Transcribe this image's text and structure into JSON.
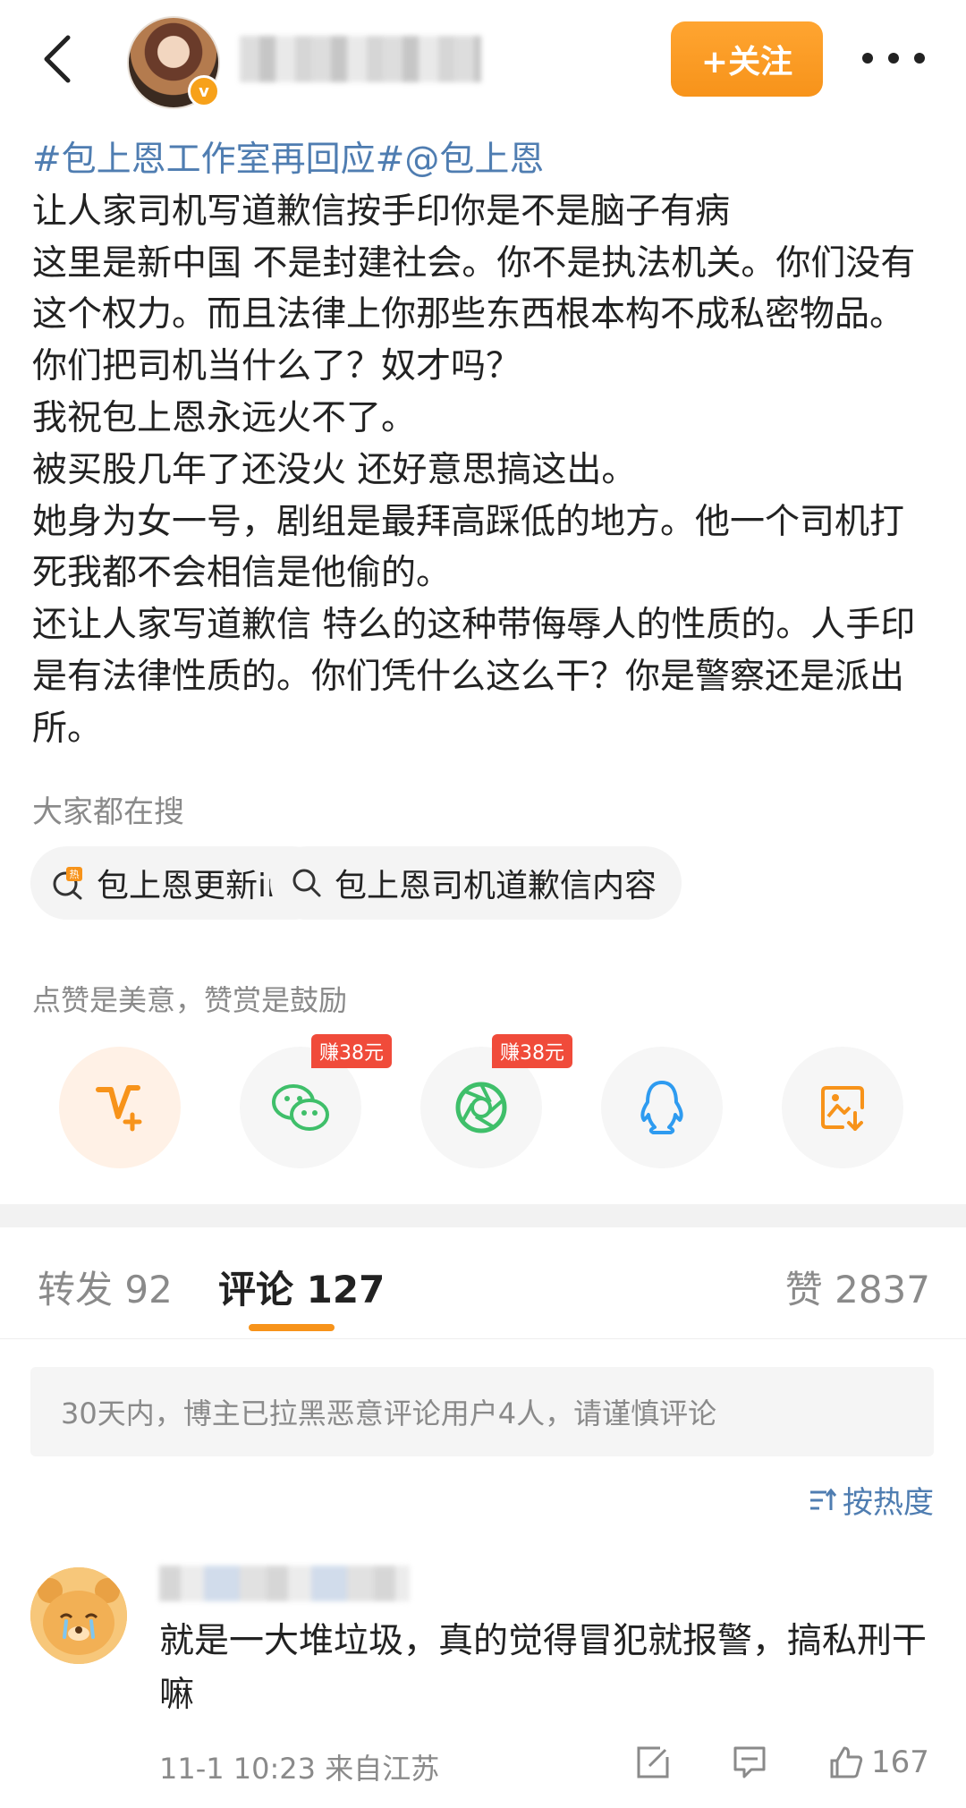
{
  "header": {
    "follow_label": "+关注"
  },
  "post": {
    "topic": "#包上恩工作室再回应#@包上恩",
    "lines": [
      "让人家司机写道歉信按手印你是不是脑子有病",
      "这里是新中国 不是封建社会。你不是执法机关。你们没有这个权力。而且法律上你那些东西根本构不成私密物品。你们把司机当什么了？奴才吗？",
      "我祝包上恩永远火不了。",
      "被买股几年了还没火 还好意思搞这出。",
      "她身为女一号，剧组是最拜高踩低的地方。他一个司机打死我都不会相信是他偷的。",
      "还让人家写道歉信 特么的这种带侮辱人的性质的。人手印是有法律性质的。你们凭什么这么干？你是警察还是派出所。"
    ]
  },
  "search": {
    "title": "大家都在搜",
    "chips": [
      "包上恩更新ins",
      "包上恩司机道歉信内容"
    ]
  },
  "reward": {
    "title": "点赞是美意，赞赏是鼓励",
    "earn_badge_1": "赚38元",
    "earn_badge_2": "赚38元"
  },
  "tabs": {
    "repost": "转发 92",
    "comments": "评论 127",
    "likes": "赞 2837"
  },
  "notice": "30天内，博主已拉黑恶意评论用户4人，请谨慎评论",
  "sort_label": "按热度",
  "comment": {
    "text": "就是一大堆垃圾，真的觉得冒犯就报警，搞私刑干嘛",
    "meta": "11-1 10:23 来自江苏",
    "likes": "167"
  },
  "colors": {
    "accent": "#f7931a",
    "link": "#4f7db1",
    "wechat_green": "#3fbf6a",
    "qq_blue": "#2e9bf0"
  }
}
